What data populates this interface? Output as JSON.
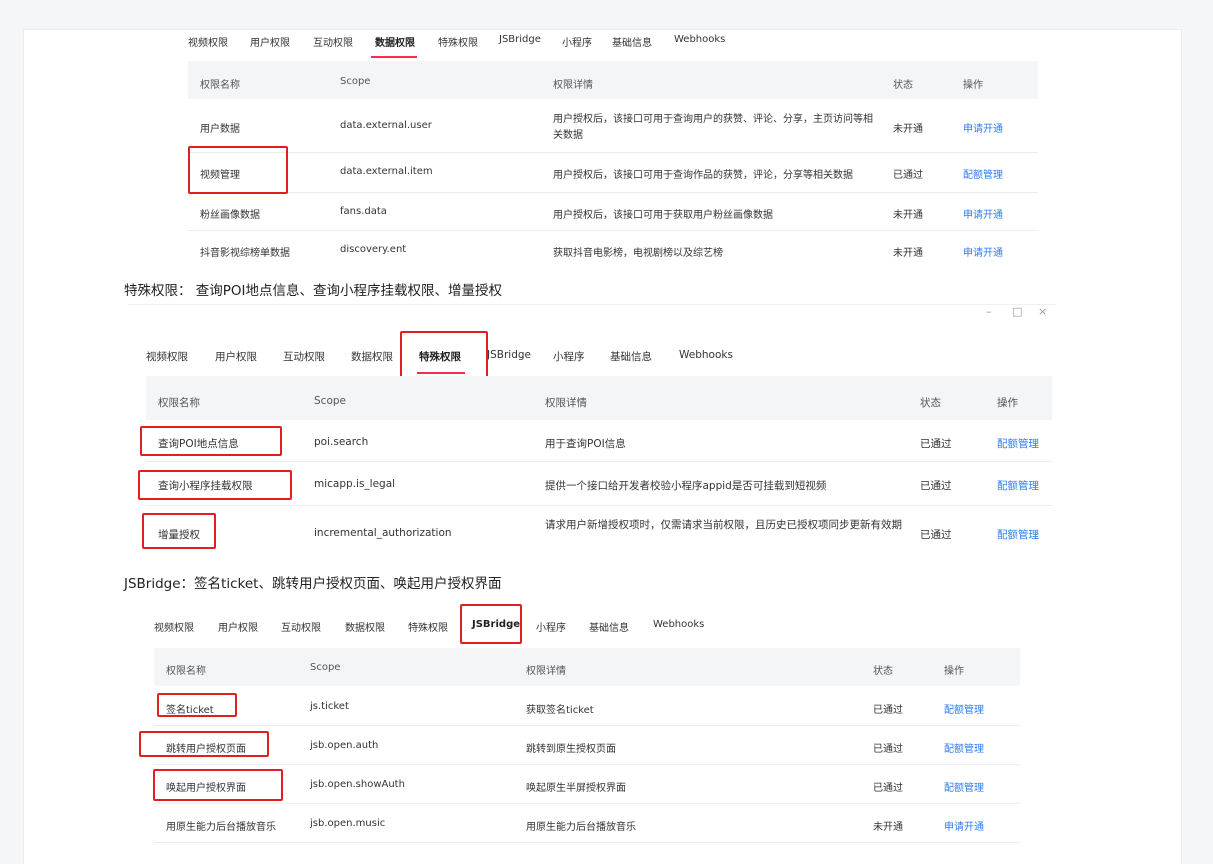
{
  "shot1": {
    "tabs": [
      "视频权限",
      "用户权限",
      "互动权限",
      "数据权限",
      "特殊权限",
      "JSBridge",
      "小程序",
      "基础信息",
      "Webhooks"
    ],
    "active_tab": "数据权限",
    "headers": [
      "权限名称",
      "Scope",
      "权限详情",
      "状态",
      "操作"
    ],
    "rows": [
      {
        "name": "用户数据",
        "scope": "data.external.user",
        "detail": "用户授权后，该接口可用于查询用户的获赞、评论、分享，主页访问等相关数据",
        "status": "未开通",
        "action": "申请开通"
      },
      {
        "name": "视频管理",
        "scope": "data.external.item",
        "detail": "用户授权后，该接口可用于查询作品的获赞，评论，分享等相关数据",
        "status": "已通过",
        "action": "配额管理"
      },
      {
        "name": "粉丝画像数据",
        "scope": "fans.data",
        "detail": "用户授权后，该接口可用于获取用户粉丝画像数据",
        "status": "未开通",
        "action": "申请开通"
      },
      {
        "name": "抖音影视综榜单数据",
        "scope": "discovery.ent",
        "detail": "获取抖音电影榜，电视剧榜以及综艺榜",
        "status": "未开通",
        "action": "申请开通"
      }
    ]
  },
  "section2_title": "特殊权限： 查询POI地点信息、查询小程序挂载权限、增量授权",
  "shot2": {
    "window_controls": [
      "–",
      "□",
      "×"
    ],
    "tabs": [
      "视频权限",
      "用户权限",
      "互动权限",
      "数据权限",
      "特殊权限",
      "JSBridge",
      "小程序",
      "基础信息",
      "Webhooks"
    ],
    "active_tab": "特殊权限",
    "headers": [
      "权限名称",
      "Scope",
      "权限详情",
      "状态",
      "操作"
    ],
    "rows": [
      {
        "name": "查询POI地点信息",
        "scope": "poi.search",
        "detail": "用于查询POI信息",
        "status": "已通过",
        "action": "配额管理"
      },
      {
        "name": "查询小程序挂载权限",
        "scope": "micapp.is_legal",
        "detail": "提供一个接口给开发者校验小程序appid是否可挂载到短视频",
        "status": "已通过",
        "action": "配额管理"
      },
      {
        "name": "增量授权",
        "scope": "incremental_authorization",
        "detail": "请求用户新增授权项时，仅需请求当前权限，且历史已授权项同步更新有效期",
        "status": "已通过",
        "action": "配额管理"
      }
    ]
  },
  "section3_title": "JSBridge：签名ticket、跳转用户授权页面、唤起用户授权界面",
  "shot3": {
    "tabs": [
      "视频权限",
      "用户权限",
      "互动权限",
      "数据权限",
      "特殊权限",
      "JSBridge",
      "小程序",
      "基础信息",
      "Webhooks"
    ],
    "active_tab": "JSBridge",
    "headers": [
      "权限名称",
      "Scope",
      "权限详情",
      "状态",
      "操作"
    ],
    "rows": [
      {
        "name": "签名ticket",
        "scope": "js.ticket",
        "detail": "获取签名ticket",
        "status": "已通过",
        "action": "配额管理"
      },
      {
        "name": "跳转用户授权页面",
        "scope": "jsb.open.auth",
        "detail": "跳转到原生授权页面",
        "status": "已通过",
        "action": "配额管理"
      },
      {
        "name": "唤起用户授权界面",
        "scope": "jsb.open.showAuth",
        "detail": "唤起原生半屏授权界面",
        "status": "已通过",
        "action": "配额管理"
      },
      {
        "name": "用原生能力后台播放音乐",
        "scope": "jsb.open.music",
        "detail": "用原生能力后台播放音乐",
        "status": "未开通",
        "action": "申请开通"
      }
    ]
  },
  "colors": {
    "accent_link": "#2f7df6",
    "active_underline": "#fe2c55",
    "highlight_box": "#e02020",
    "header_bg": "#f4f5f7"
  }
}
